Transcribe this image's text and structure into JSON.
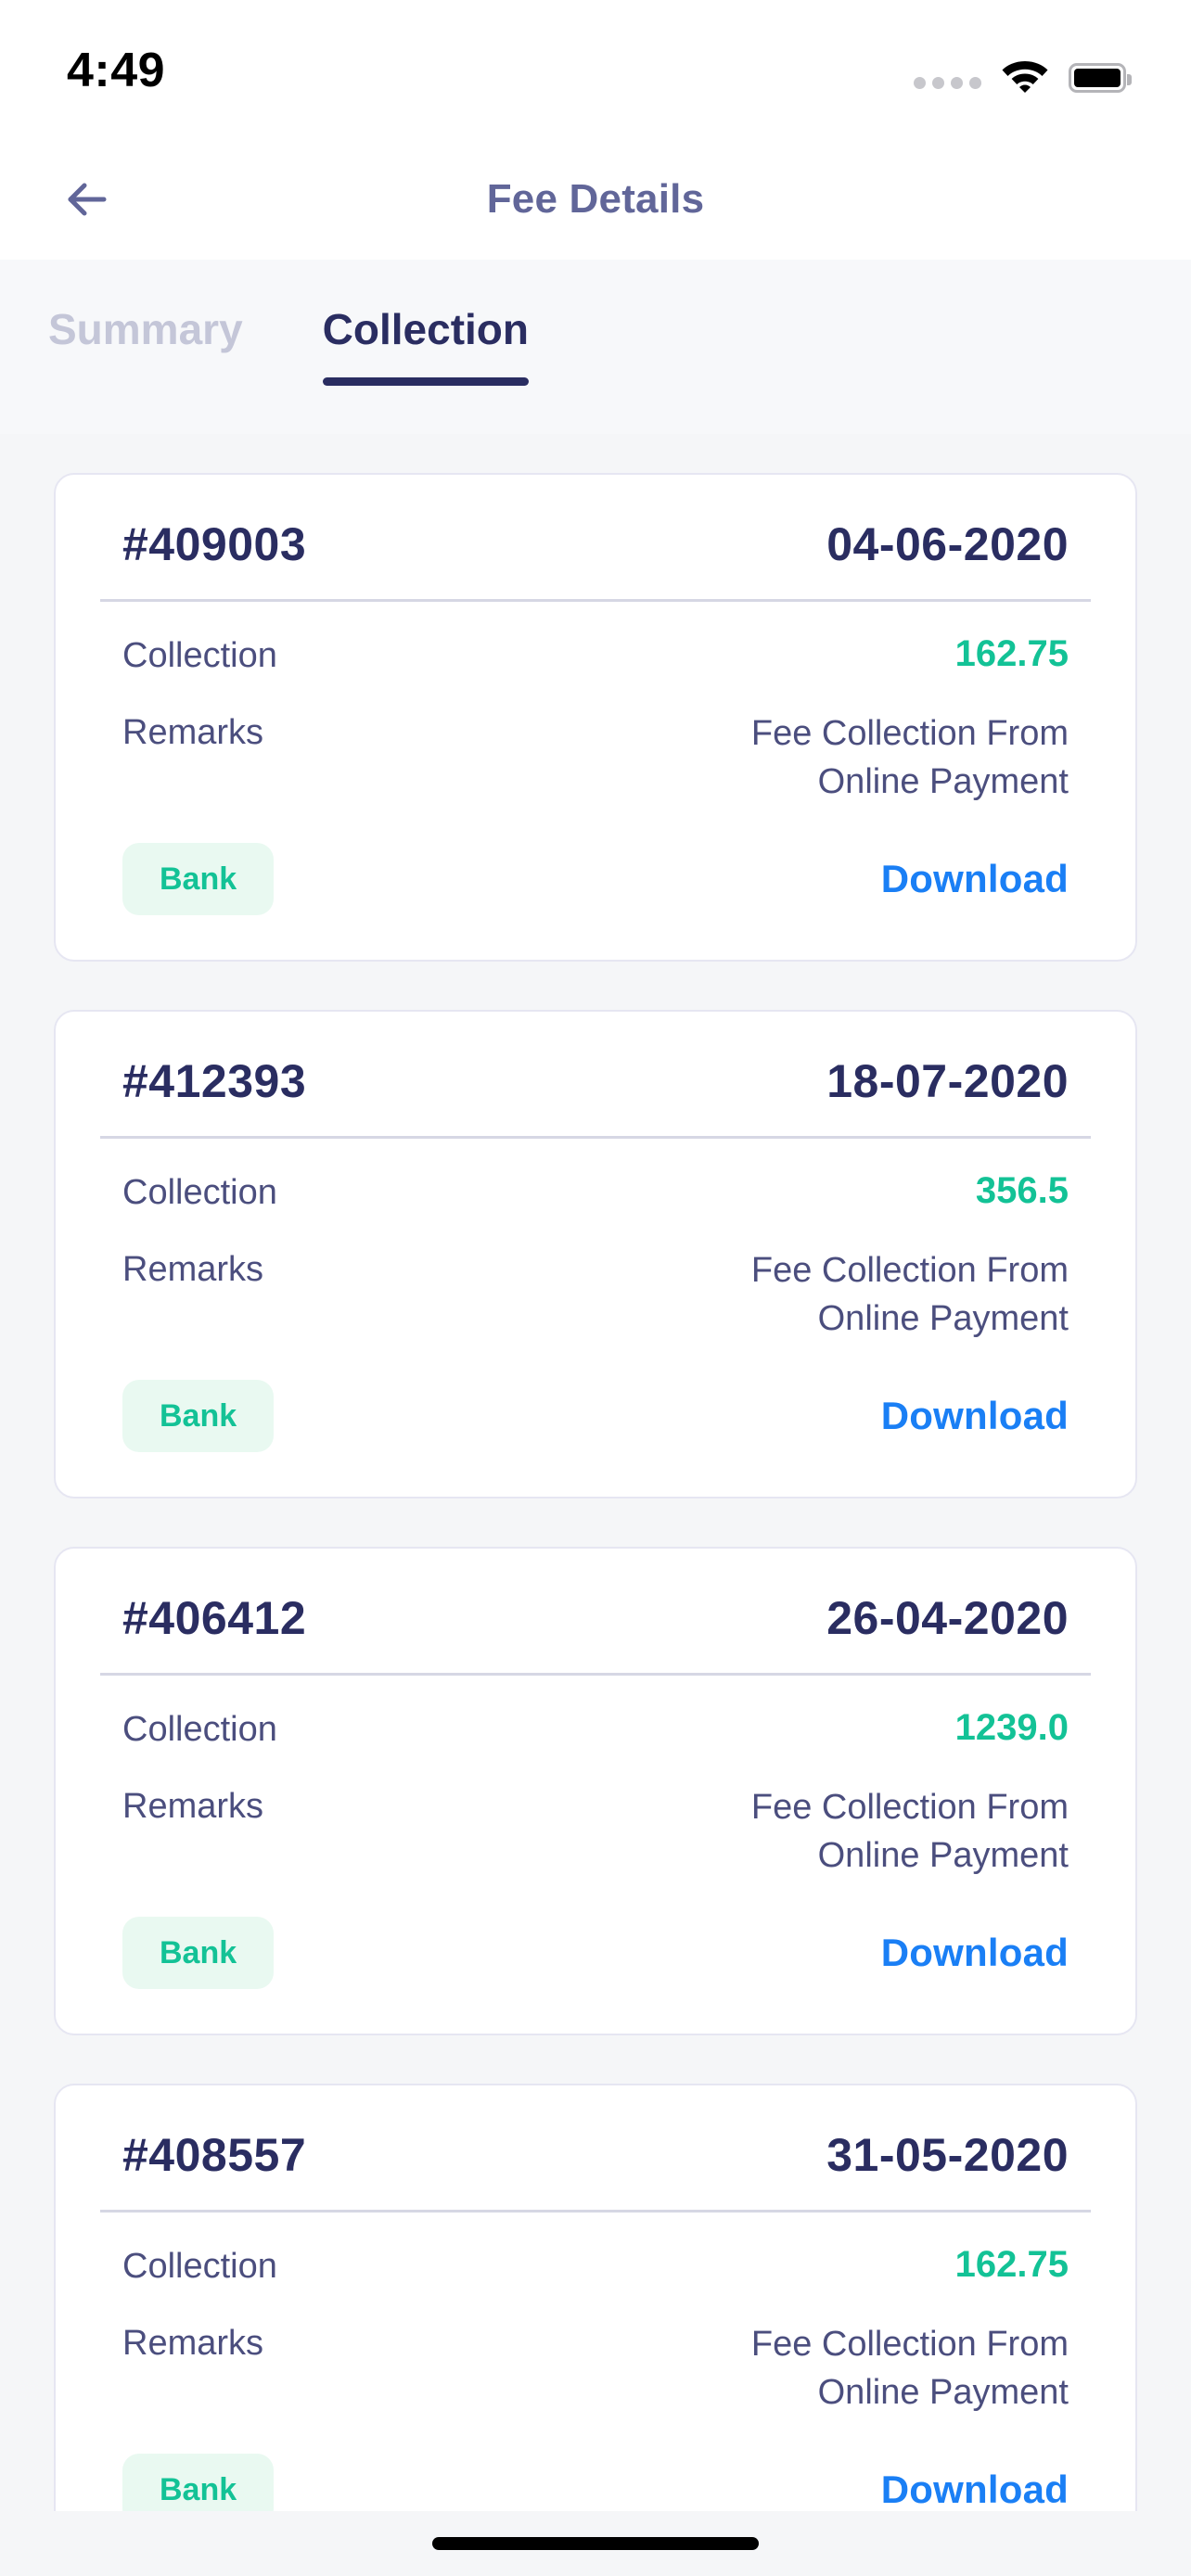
{
  "status_bar": {
    "time": "4:49",
    "cellular_icon": "cellular-dots-icon",
    "wifi_icon": "wifi-icon",
    "battery_icon": "battery-full-icon"
  },
  "header": {
    "back_icon": "back-arrow-icon",
    "title": "Fee Details"
  },
  "tabs": [
    {
      "label": "Summary",
      "active": false
    },
    {
      "label": "Collection",
      "active": true
    }
  ],
  "labels": {
    "collection": "Collection",
    "remarks": "Remarks",
    "download": "Download"
  },
  "colors": {
    "title": "#616699",
    "tab_active": "#2a2d61",
    "tab_inactive": "#c4c6d8",
    "amount_green": "#13c296",
    "download_blue": "#1a7ff5",
    "badge_bg": "#e9f9f1",
    "card_border": "#e6e6f2",
    "page_bg": "#f5f6f8"
  },
  "cards": [
    {
      "receipt_no": "#409003",
      "date": "04-06-2020",
      "collection_label": "Collection",
      "amount": "162.75",
      "remarks_label": "Remarks",
      "remarks": "Fee Collection From Online Payment",
      "mode": "Bank",
      "download": "Download"
    },
    {
      "receipt_no": "#412393",
      "date": "18-07-2020",
      "collection_label": "Collection",
      "amount": "356.5",
      "remarks_label": "Remarks",
      "remarks": "Fee Collection From Online Payment",
      "mode": "Bank",
      "download": "Download"
    },
    {
      "receipt_no": "#406412",
      "date": "26-04-2020",
      "collection_label": "Collection",
      "amount": "1239.0",
      "remarks_label": "Remarks",
      "remarks": "Fee Collection From Online Payment",
      "mode": "Bank",
      "download": "Download"
    },
    {
      "receipt_no": "#408557",
      "date": "31-05-2020",
      "collection_label": "Collection",
      "amount": "162.75",
      "remarks_label": "Remarks",
      "remarks": "Fee Collection From Online Payment",
      "mode": "Bank",
      "download": "Download"
    }
  ]
}
